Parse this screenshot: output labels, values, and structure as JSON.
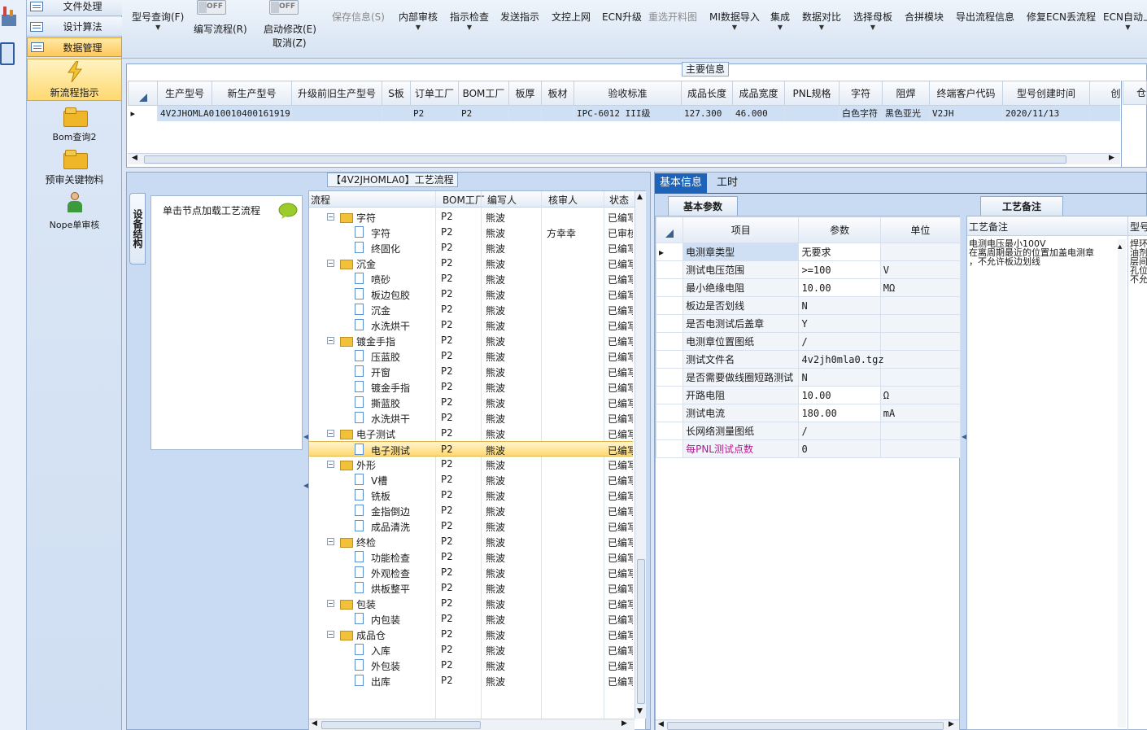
{
  "left_nav": {
    "tabs": [
      "文件处理",
      "设计算法",
      "数据管理"
    ],
    "items": [
      "新流程指示",
      "Bom查询2",
      "预审关键物料",
      "Nope单审核"
    ]
  },
  "toolbar": {
    "model_query": "型号查询(F)",
    "write_flow": "编写流程(R)",
    "start_modify": "启动修改(E)",
    "cancel": "取消(Z)",
    "toggle_off": "OFF",
    "save_info": "保存信息(S)",
    "internal_review": "内部审核",
    "instruction_check": "指示检查",
    "send_instruction": "发送指示",
    "doc_upload": "文控上网",
    "ecn_upgrade": "ECN升级",
    "reselect_cutting": "重选开料图",
    "mi_import": "MI数据导入",
    "integrate": "集成",
    "data_compare": "数据对比",
    "select_master": "选择母板",
    "merge_module": "合拼模块",
    "export_flow": "导出流程信息",
    "repair_ecn": "修复ECN丢流程",
    "ecn_auto": "ECN自动上"
  },
  "main_info": {
    "title": "主要信息",
    "columns": [
      "生产型号",
      "新生产型号",
      "升级前旧生产型号",
      "S板",
      "订单工厂",
      "BOM工厂",
      "板厚",
      "板材",
      "验收标准",
      "成品长度",
      "成品宽度",
      "PNL规格",
      "字符",
      "阻焊",
      "终端客户代码",
      "型号创建时间",
      "创建"
    ],
    "row": [
      "4V2JHOMLA0",
      "10010400161919",
      "",
      "",
      "P2",
      "P2",
      "",
      "",
      "IPC-6012 III级",
      "127.300",
      "46.000",
      "",
      "白色字符",
      "黑色亚光",
      "V2JH",
      "2020/11/13",
      ""
    ]
  },
  "flow": {
    "title": "【4V2JHOMLA0】工艺流程",
    "side_tab": "设备结构",
    "node_hint": "单击节点加载工艺流程",
    "columns": [
      "流程",
      "BOM工厂",
      "编写人",
      "核审人",
      "状态"
    ],
    "rows": [
      {
        "name": "字符",
        "level": 0,
        "factory": "P2",
        "writer": "熊波",
        "reviewer": "",
        "status": "已编写"
      },
      {
        "name": "字符",
        "level": 1,
        "factory": "P2",
        "writer": "熊波",
        "reviewer": "方幸幸",
        "status": "已审核"
      },
      {
        "name": "终固化",
        "level": 1,
        "factory": "P2",
        "writer": "熊波",
        "reviewer": "",
        "status": "已编写"
      },
      {
        "name": "沉金",
        "level": 0,
        "factory": "P2",
        "writer": "熊波",
        "reviewer": "",
        "status": "已编写"
      },
      {
        "name": "喷砂",
        "level": 1,
        "factory": "P2",
        "writer": "熊波",
        "reviewer": "",
        "status": "已编写"
      },
      {
        "name": "板边包胶",
        "level": 1,
        "factory": "P2",
        "writer": "熊波",
        "reviewer": "",
        "status": "已编写"
      },
      {
        "name": "沉金",
        "level": 1,
        "factory": "P2",
        "writer": "熊波",
        "reviewer": "",
        "status": "已编写"
      },
      {
        "name": "水洗烘干",
        "level": 1,
        "factory": "P2",
        "writer": "熊波",
        "reviewer": "",
        "status": "已编写"
      },
      {
        "name": "镀金手指",
        "level": 0,
        "factory": "P2",
        "writer": "熊波",
        "reviewer": "",
        "status": "已编写"
      },
      {
        "name": "压蓝胶",
        "level": 1,
        "factory": "P2",
        "writer": "熊波",
        "reviewer": "",
        "status": "已编写"
      },
      {
        "name": "开窗",
        "level": 1,
        "factory": "P2",
        "writer": "熊波",
        "reviewer": "",
        "status": "已编写"
      },
      {
        "name": "镀金手指",
        "level": 1,
        "factory": "P2",
        "writer": "熊波",
        "reviewer": "",
        "status": "已编写"
      },
      {
        "name": "撕蓝胶",
        "level": 1,
        "factory": "P2",
        "writer": "熊波",
        "reviewer": "",
        "status": "已编写"
      },
      {
        "name": "水洗烘干",
        "level": 1,
        "factory": "P2",
        "writer": "熊波",
        "reviewer": "",
        "status": "已编写"
      },
      {
        "name": "电子测试",
        "level": 0,
        "factory": "P2",
        "writer": "熊波",
        "reviewer": "",
        "status": "已编写"
      },
      {
        "name": "电子测试",
        "level": 1,
        "factory": "P2",
        "writer": "熊波",
        "reviewer": "",
        "status": "已编写",
        "selected": true
      },
      {
        "name": "外形",
        "level": 0,
        "factory": "P2",
        "writer": "熊波",
        "reviewer": "",
        "status": "已编写"
      },
      {
        "name": "V槽",
        "level": 1,
        "factory": "P2",
        "writer": "熊波",
        "reviewer": "",
        "status": "已编写"
      },
      {
        "name": "铣板",
        "level": 1,
        "factory": "P2",
        "writer": "熊波",
        "reviewer": "",
        "status": "已编写"
      },
      {
        "name": "金指倒边",
        "level": 1,
        "factory": "P2",
        "writer": "熊波",
        "reviewer": "",
        "status": "已编写"
      },
      {
        "name": "成品清洗",
        "level": 1,
        "factory": "P2",
        "writer": "熊波",
        "reviewer": "",
        "status": "已编写"
      },
      {
        "name": "终检",
        "level": 0,
        "factory": "P2",
        "writer": "熊波",
        "reviewer": "",
        "status": "已编写"
      },
      {
        "name": "功能检查",
        "level": 1,
        "factory": "P2",
        "writer": "熊波",
        "reviewer": "",
        "status": "已编写"
      },
      {
        "name": "外观检查",
        "level": 1,
        "factory": "P2",
        "writer": "熊波",
        "reviewer": "",
        "status": "已编写"
      },
      {
        "name": "烘板整平",
        "level": 1,
        "factory": "P2",
        "writer": "熊波",
        "reviewer": "",
        "status": "已编写"
      },
      {
        "name": "包装",
        "level": 0,
        "factory": "P2",
        "writer": "熊波",
        "reviewer": "",
        "status": "已编写"
      },
      {
        "name": "内包装",
        "level": 1,
        "factory": "P2",
        "writer": "熊波",
        "reviewer": "",
        "status": "已编写"
      },
      {
        "name": "成品仓",
        "level": 0,
        "factory": "P2",
        "writer": "熊波",
        "reviewer": "",
        "status": "已编写"
      },
      {
        "name": "入库",
        "level": 1,
        "factory": "P2",
        "writer": "熊波",
        "reviewer": "",
        "status": "已编写"
      },
      {
        "name": "外包装",
        "level": 1,
        "factory": "P2",
        "writer": "熊波",
        "reviewer": "",
        "status": "已编写"
      },
      {
        "name": "出库",
        "level": 1,
        "factory": "P2",
        "writer": "熊波",
        "reviewer": "",
        "status": "已编写"
      }
    ]
  },
  "details": {
    "tabs": [
      "基本信息",
      "工时"
    ],
    "params_tab": "基本参数",
    "notes_tab": "工艺备注",
    "columns": [
      "项目",
      "参数",
      "单位"
    ],
    "params": [
      {
        "item": "电测章类型",
        "value": "无要求",
        "unit": ""
      },
      {
        "item": "测试电压范围",
        "value": ">=100",
        "unit": "V"
      },
      {
        "item": "最小绝缘电阻",
        "value": "10.00",
        "unit": "MΩ"
      },
      {
        "item": "板边是否划线",
        "value": "N",
        "unit": ""
      },
      {
        "item": "是否电测试后盖章",
        "value": "Y",
        "unit": ""
      },
      {
        "item": "电测章位置图纸",
        "value": "/",
        "unit": ""
      },
      {
        "item": "测试文件名",
        "value": "4v2jh0mla0.tgz",
        "unit": ""
      },
      {
        "item": "是否需要做线圈短路测试",
        "value": "N",
        "unit": ""
      },
      {
        "item": "开路电阻",
        "value": "10.00",
        "unit": "Ω"
      },
      {
        "item": "测试电流",
        "value": "180.00",
        "unit": "mA"
      },
      {
        "item": "长网络测量图纸",
        "value": "/",
        "unit": ""
      },
      {
        "item": "每PNL测试点数",
        "value": "0",
        "unit": ""
      }
    ],
    "notes_columns": [
      "工艺备注",
      "型号"
    ],
    "note_text": "电测电压最小100V\n在离周期最近的位置加盖电测章\n，不允许板边划线",
    "model_note": "焊环\n油剂\n层间\n孔位\n不允"
  }
}
